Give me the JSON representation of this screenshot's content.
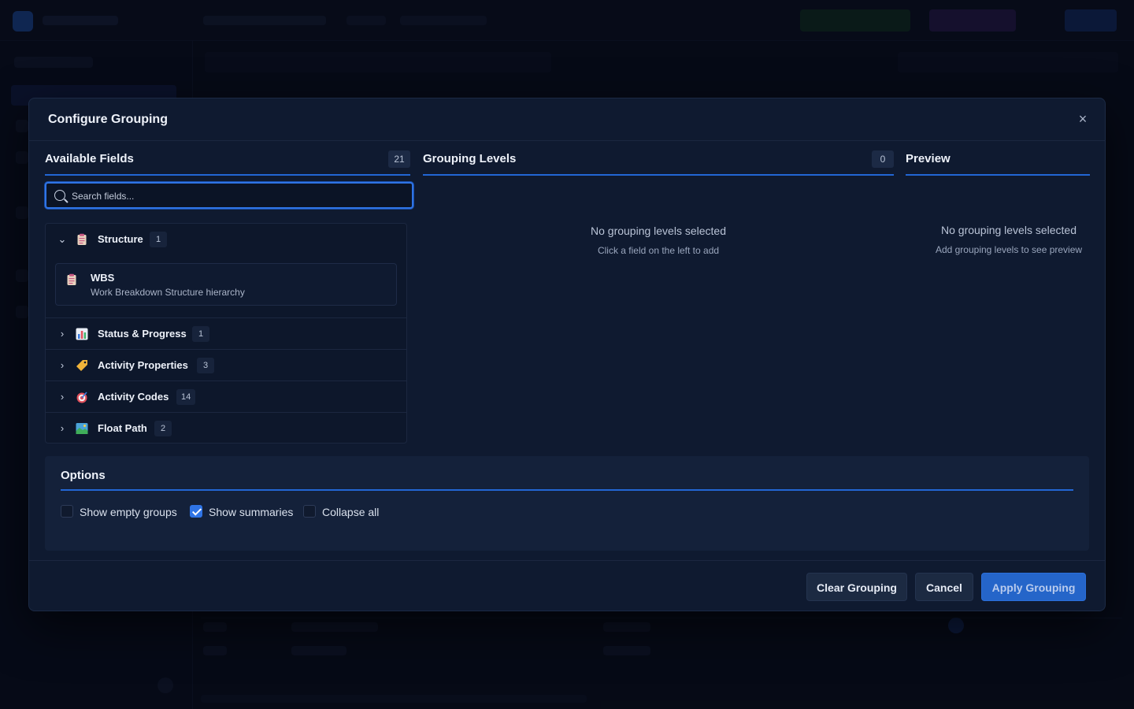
{
  "dialog": {
    "title": "Configure Grouping",
    "close_label": "×"
  },
  "available_fields": {
    "title": "Available Fields",
    "count": "21",
    "search_placeholder": "Search fields...",
    "groups": [
      {
        "label": "Structure",
        "count": "1",
        "expanded": true,
        "icon": "clipboard-icon",
        "fields": [
          {
            "name": "WBS",
            "description": "Work Breakdown Structure hierarchy",
            "icon": "clipboard-icon"
          }
        ]
      },
      {
        "label": "Status & Progress",
        "count": "1",
        "expanded": false,
        "icon": "bar-chart-icon"
      },
      {
        "label": "Activity Properties",
        "count": "3",
        "expanded": false,
        "icon": "tag-icon"
      },
      {
        "label": "Activity Codes",
        "count": "14",
        "expanded": false,
        "icon": "target-icon"
      },
      {
        "label": "Float Path",
        "count": "2",
        "expanded": false,
        "icon": "landscape-icon"
      }
    ]
  },
  "grouping_levels": {
    "title": "Grouping Levels",
    "count": "0",
    "empty_title": "No grouping levels selected",
    "empty_sub": "Click a field on the left to add"
  },
  "preview": {
    "title": "Preview",
    "empty_title": "No grouping levels selected",
    "empty_sub": "Add grouping levels to see preview"
  },
  "options": {
    "title": "Options",
    "items": [
      {
        "label": "Show empty groups",
        "checked": false
      },
      {
        "label": "Show summaries",
        "checked": true
      },
      {
        "label": "Collapse all",
        "checked": false
      }
    ]
  },
  "footer": {
    "clear_label": "Clear Grouping",
    "cancel_label": "Cancel",
    "apply_label": "Apply Grouping"
  },
  "colors": {
    "accent": "#2f74e6",
    "background": "#0f1a30"
  }
}
